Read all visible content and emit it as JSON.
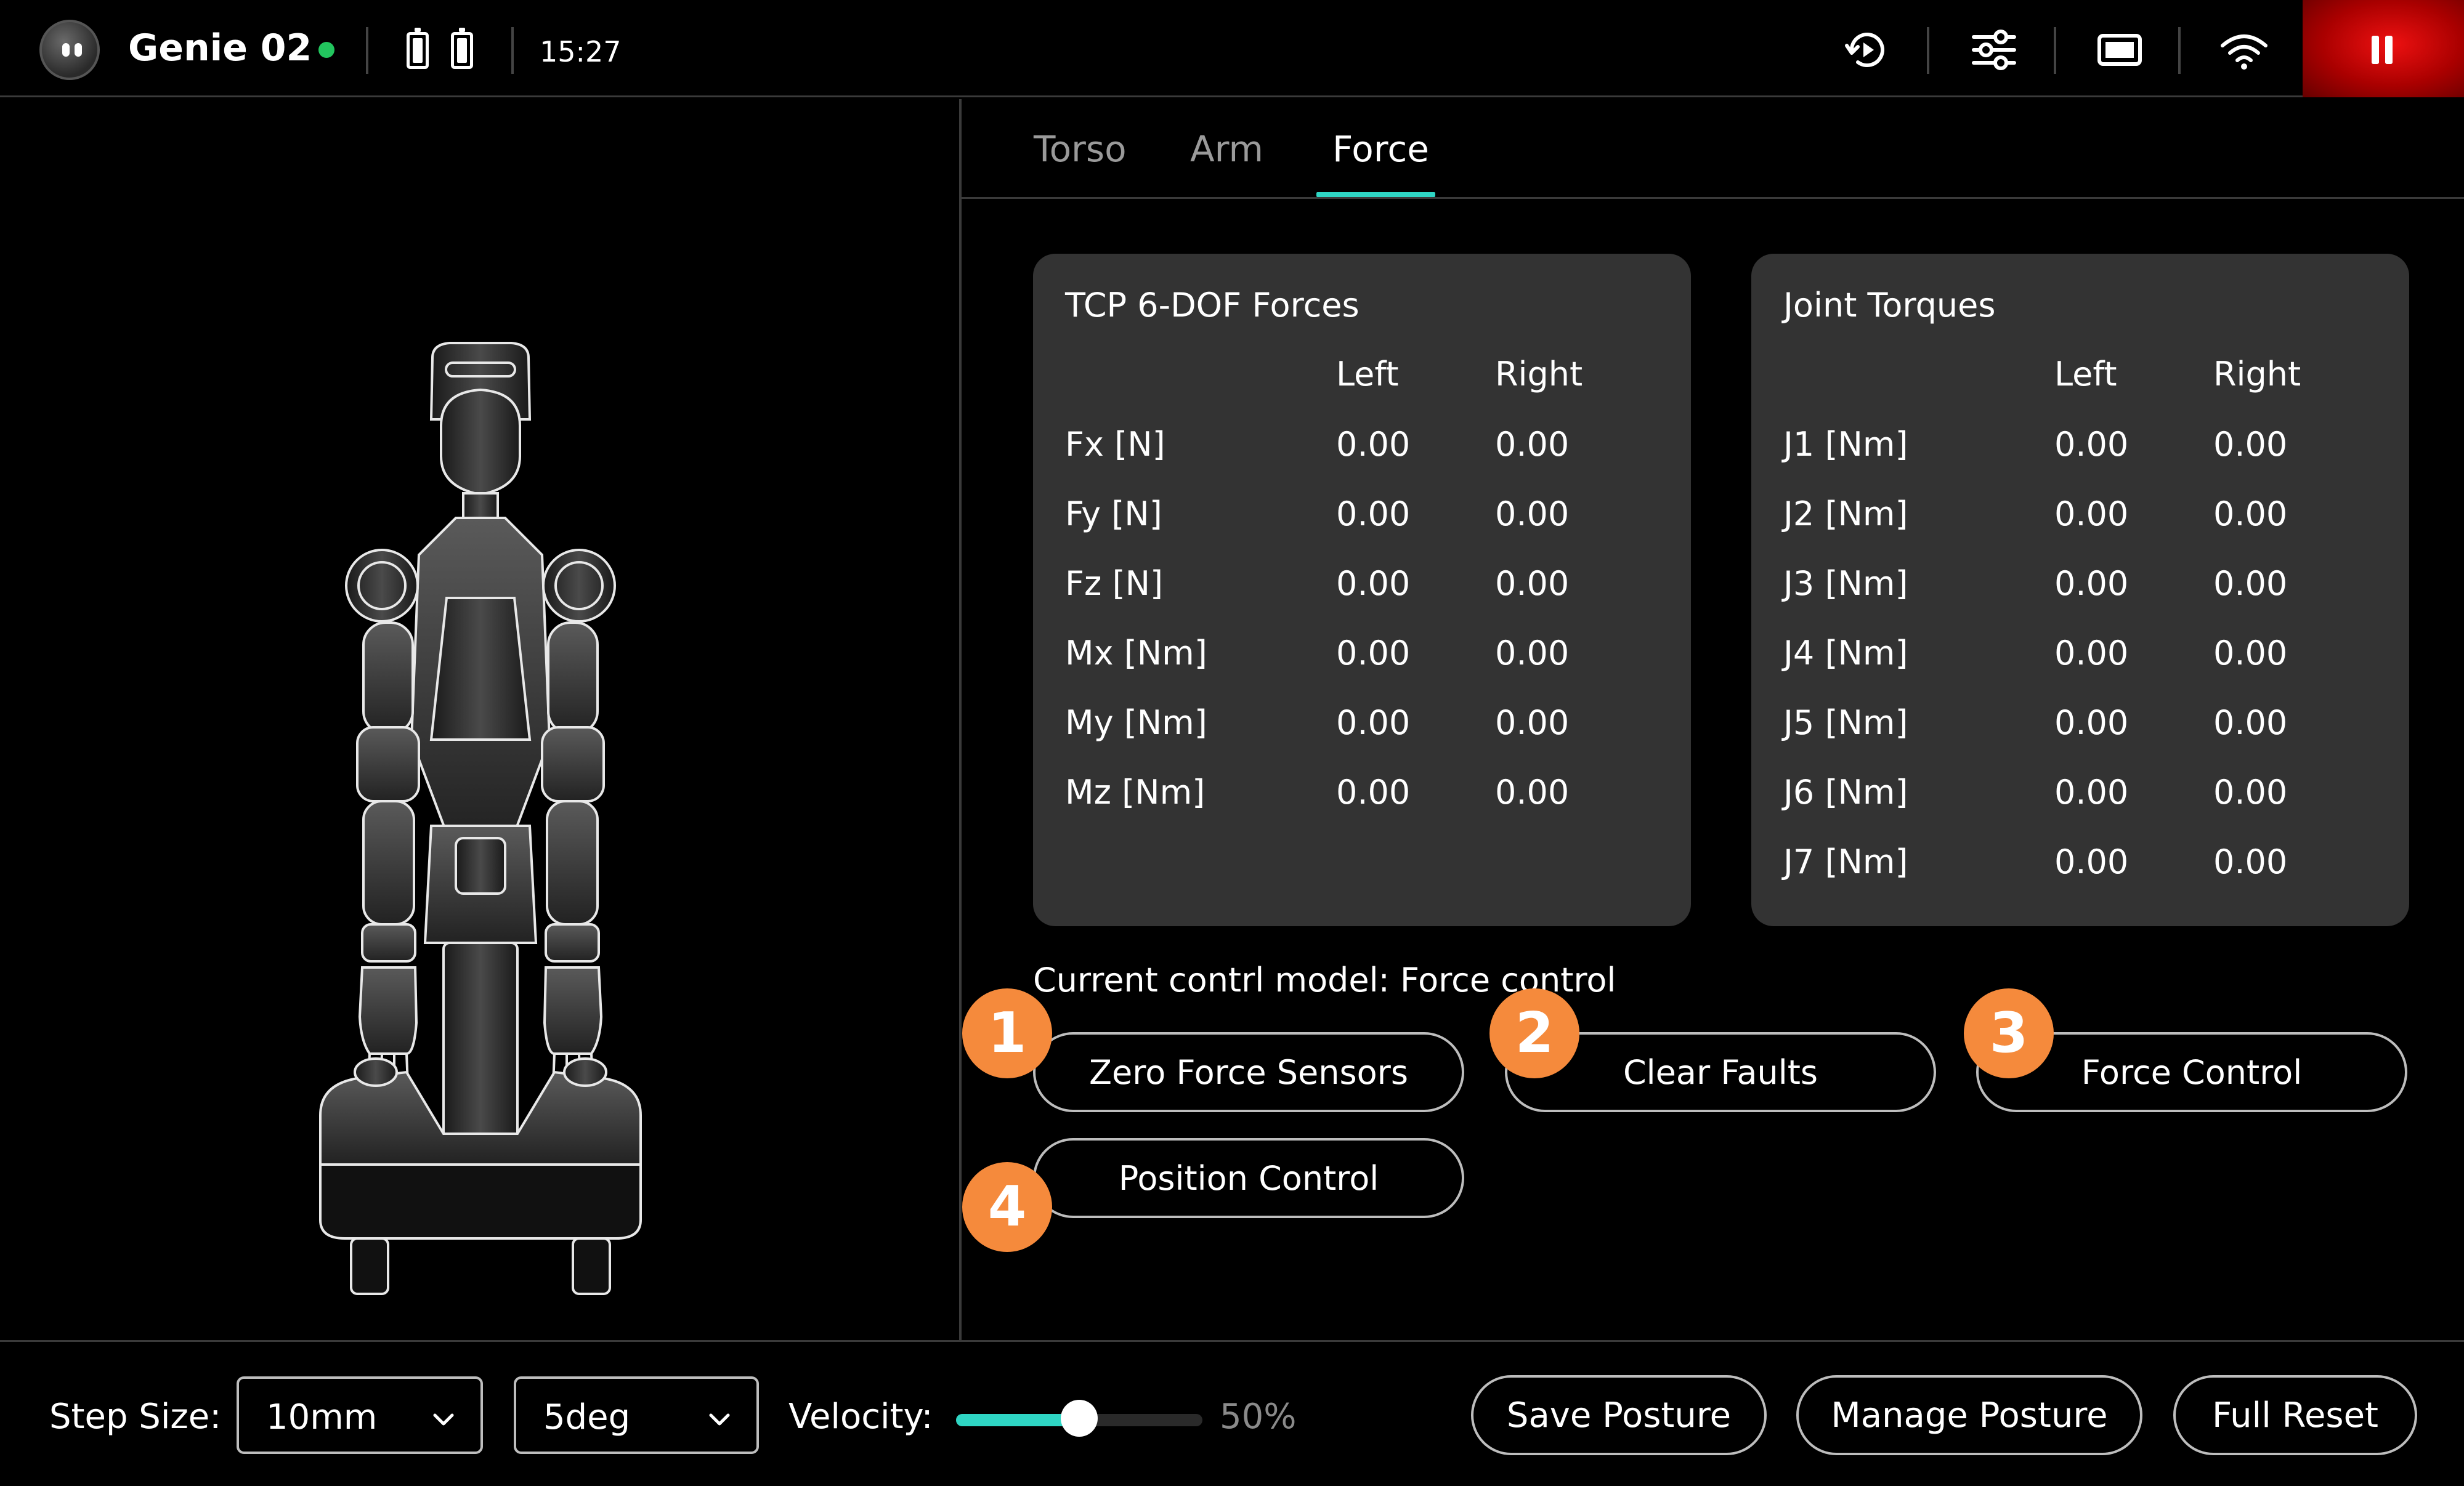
{
  "header": {
    "robot_name": "Genie 02",
    "time": "15:27",
    "status_color": "#22c55e",
    "icons": [
      "robot-logo-icon",
      "battery-icon",
      "battery-icon",
      "replay-icon",
      "sliders-icon",
      "screen-icon",
      "wifi-icon",
      "pause-icon"
    ]
  },
  "tabs": [
    {
      "label": "Torso",
      "active": false
    },
    {
      "label": "Arm",
      "active": false
    },
    {
      "label": "Force",
      "active": true
    }
  ],
  "tcp_card": {
    "title": "TCP 6-DOF Forces",
    "col_left": "Left",
    "col_right": "Right",
    "rows": [
      {
        "label": "Fx [N]",
        "left": "0.00",
        "right": "0.00"
      },
      {
        "label": "Fy [N]",
        "left": "0.00",
        "right": "0.00"
      },
      {
        "label": "Fz [N]",
        "left": "0.00",
        "right": "0.00"
      },
      {
        "label": "Mx [Nm]",
        "left": "0.00",
        "right": "0.00"
      },
      {
        "label": "My [Nm]",
        "left": "0.00",
        "right": "0.00"
      },
      {
        "label": "Mz [Nm]",
        "left": "0.00",
        "right": "0.00"
      }
    ]
  },
  "joint_card": {
    "title": "Joint Torques",
    "col_left": "Left",
    "col_right": "Right",
    "rows": [
      {
        "label": "J1 [Nm]",
        "left": "0.00",
        "right": "0.00"
      },
      {
        "label": "J2 [Nm]",
        "left": "0.00",
        "right": "0.00"
      },
      {
        "label": "J3 [Nm]",
        "left": "0.00",
        "right": "0.00"
      },
      {
        "label": "J4 [Nm]",
        "left": "0.00",
        "right": "0.00"
      },
      {
        "label": "J5 [Nm]",
        "left": "0.00",
        "right": "0.00"
      },
      {
        "label": "J6 [Nm]",
        "left": "0.00",
        "right": "0.00"
      },
      {
        "label": "J7 [Nm]",
        "left": "0.00",
        "right": "0.00"
      }
    ]
  },
  "control": {
    "mode_text": "Current contrl model: Force control",
    "buttons": [
      {
        "label": "Zero Force Sensors",
        "badge": "1"
      },
      {
        "label": "Clear Faults",
        "badge": "2"
      },
      {
        "label": "Force Control",
        "badge": "3"
      },
      {
        "label": "Position Control",
        "badge": "4"
      }
    ],
    "badge_color": "#f58a3c"
  },
  "footer": {
    "step_size_label": "Step Size:",
    "step_size_value": "10mm",
    "angle_step_value": "5deg",
    "velocity_label": "Velocity:",
    "velocity_value": "50%",
    "velocity_fraction": 0.5,
    "accent_color": "#2fd6c4",
    "save_posture": "Save Posture",
    "manage_posture": "Manage Posture",
    "full_reset": "Full Reset"
  }
}
